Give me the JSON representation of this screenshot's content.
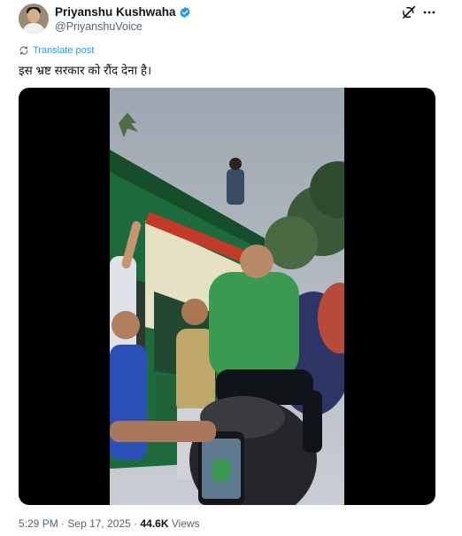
{
  "author": {
    "name": "Priyanshu Kushwaha",
    "handle": "@PriyanshuVoice"
  },
  "icons": {
    "verified": "verified-badge-icon",
    "grok": "grok-icon",
    "more": "more-options-icon",
    "translate": "translate-icon"
  },
  "colors": {
    "accent": "#1d9bf0",
    "text": "#0f1419",
    "secondary": "#536471"
  },
  "translate_label": "Translate post",
  "tweet_text": "इस भ्रष्ट सरकार को रौंद देना है।",
  "media": {
    "type": "video"
  },
  "meta": {
    "time": "5:29 PM",
    "separator": "·",
    "date": "Sep 17, 2025",
    "views_count": "44.6K",
    "views_label": "Views"
  }
}
